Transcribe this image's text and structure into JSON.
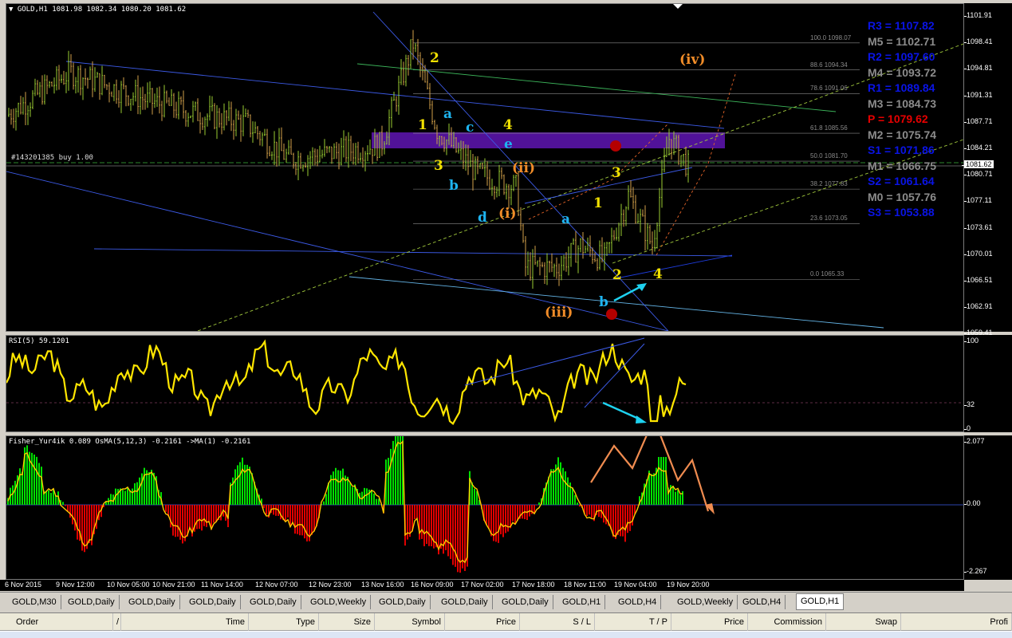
{
  "main": {
    "header": "GOLD,H1  1081.98 1082.34 1080.20 1081.62",
    "order_label": "#143201385 buy 1.00",
    "current_price": "1081.62",
    "yticks": [
      "1101.91",
      "1098.41",
      "1094.81",
      "1091.31",
      "1087.71",
      "1084.21",
      "1080.71",
      "1077.11",
      "1073.61",
      "1070.01",
      "1066.51",
      "1062.91",
      "1059.41"
    ]
  },
  "fib_levels": [
    "100.0 1098.07",
    "88.6 1094.34",
    "78.6 1091.06",
    "61.8 1085.56",
    "50.0 1081.70",
    "38.2 1077.83",
    "23.6 1073.05",
    "0.0 1065.33"
  ],
  "pivots": [
    {
      "label": "R3 = 1107.82",
      "color": "#0a14e6"
    },
    {
      "label": "M5 = 1102.71",
      "color": "#8c8c8c"
    },
    {
      "label": "R2 = 1097.60",
      "color": "#0a14e6"
    },
    {
      "label": "M4 = 1093.72",
      "color": "#8c8c8c"
    },
    {
      "label": "R1 = 1089.84",
      "color": "#0a14e6"
    },
    {
      "label": "M3 = 1084.73",
      "color": "#8c8c8c"
    },
    {
      "label": "P  = 1079.62",
      "color": "#e60000"
    },
    {
      "label": "M2 = 1075.74",
      "color": "#8c8c8c"
    },
    {
      "label": "S1 = 1071.86",
      "color": "#0a14e6"
    },
    {
      "label": "M1 = 1066.75",
      "color": "#8c8c8c"
    },
    {
      "label": "S2 = 1061.64",
      "color": "#0a14e6"
    },
    {
      "label": "M0 = 1057.76",
      "color": "#8c8c8c"
    },
    {
      "label": "S3 = 1053.88",
      "color": "#0a14e6"
    }
  ],
  "wave_labels": [
    {
      "t": "2",
      "c": "#f0e000"
    },
    {
      "t": "a",
      "c": "#1eb4f0"
    },
    {
      "t": "c",
      "c": "#1eb4f0"
    },
    {
      "t": "1",
      "c": "#f0e000"
    },
    {
      "t": "4",
      "c": "#f0e000"
    },
    {
      "t": "e",
      "c": "#1eb4f0"
    },
    {
      "t": "3",
      "c": "#f0e000"
    },
    {
      "t": "(ii)",
      "c": "#f08c28"
    },
    {
      "t": "b",
      "c": "#1eb4f0"
    },
    {
      "t": "d",
      "c": "#1eb4f0"
    },
    {
      "t": "(i)",
      "c": "#f08c28"
    },
    {
      "t": "3",
      "c": "#f0e000"
    },
    {
      "t": "1",
      "c": "#f0e000"
    },
    {
      "t": "a",
      "c": "#1eb4f0"
    },
    {
      "t": "2",
      "c": "#f0e000"
    },
    {
      "t": "4",
      "c": "#f0e000"
    },
    {
      "t": "b",
      "c": "#1eb4f0"
    },
    {
      "t": "(iii)",
      "c": "#f08c28"
    },
    {
      "t": "(iv)",
      "c": "#f08c28"
    }
  ],
  "rsi": {
    "header": "RSI(5) 59.1201",
    "yticks": [
      "100",
      "32",
      "0"
    ]
  },
  "fisher": {
    "header": "Fisher_Yur4ik 0.089  OsMA(5,12,3) -0.2161  ->MA(1) -0.2161",
    "yticks": [
      "2.077",
      "0.00",
      "-2.267"
    ]
  },
  "xaxis": [
    "6 Nov 2015",
    "9 Nov 12:00",
    "10 Nov 05:00",
    "10 Nov 21:00",
    "11 Nov 14:00",
    "12 Nov 07:00",
    "12 Nov 23:00",
    "13 Nov 16:00",
    "16 Nov 09:00",
    "17 Nov 02:00",
    "17 Nov 18:00",
    "18 Nov 11:00",
    "19 Nov 04:00",
    "19 Nov 20:00"
  ],
  "tabs": [
    "GOLD,M30",
    "GOLD,Daily",
    "GOLD,Daily",
    "GOLD,Daily",
    "GOLD,Daily",
    "GOLD,Weekly",
    "GOLD,Daily",
    "GOLD,Daily",
    "GOLD,Daily",
    "GOLD,H1",
    "GOLD,H4",
    "GOLD,Weekly",
    "GOLD,H4",
    "GOLD,H1"
  ],
  "terminal": {
    "headers": [
      "Order",
      "/",
      "Time",
      "Type",
      "Size",
      "Symbol",
      "Price",
      "S / L",
      "T / P",
      "Price",
      "Commission",
      "Swap",
      "Profi"
    ]
  },
  "colors": {
    "bull": "#9acd32",
    "bear": "#d2a04a",
    "rsi": "#ffe600",
    "fisher": "#ffc800",
    "hist_up": "#00e000",
    "hist_dn": "#e00000",
    "zone": "#5a14aa"
  }
}
